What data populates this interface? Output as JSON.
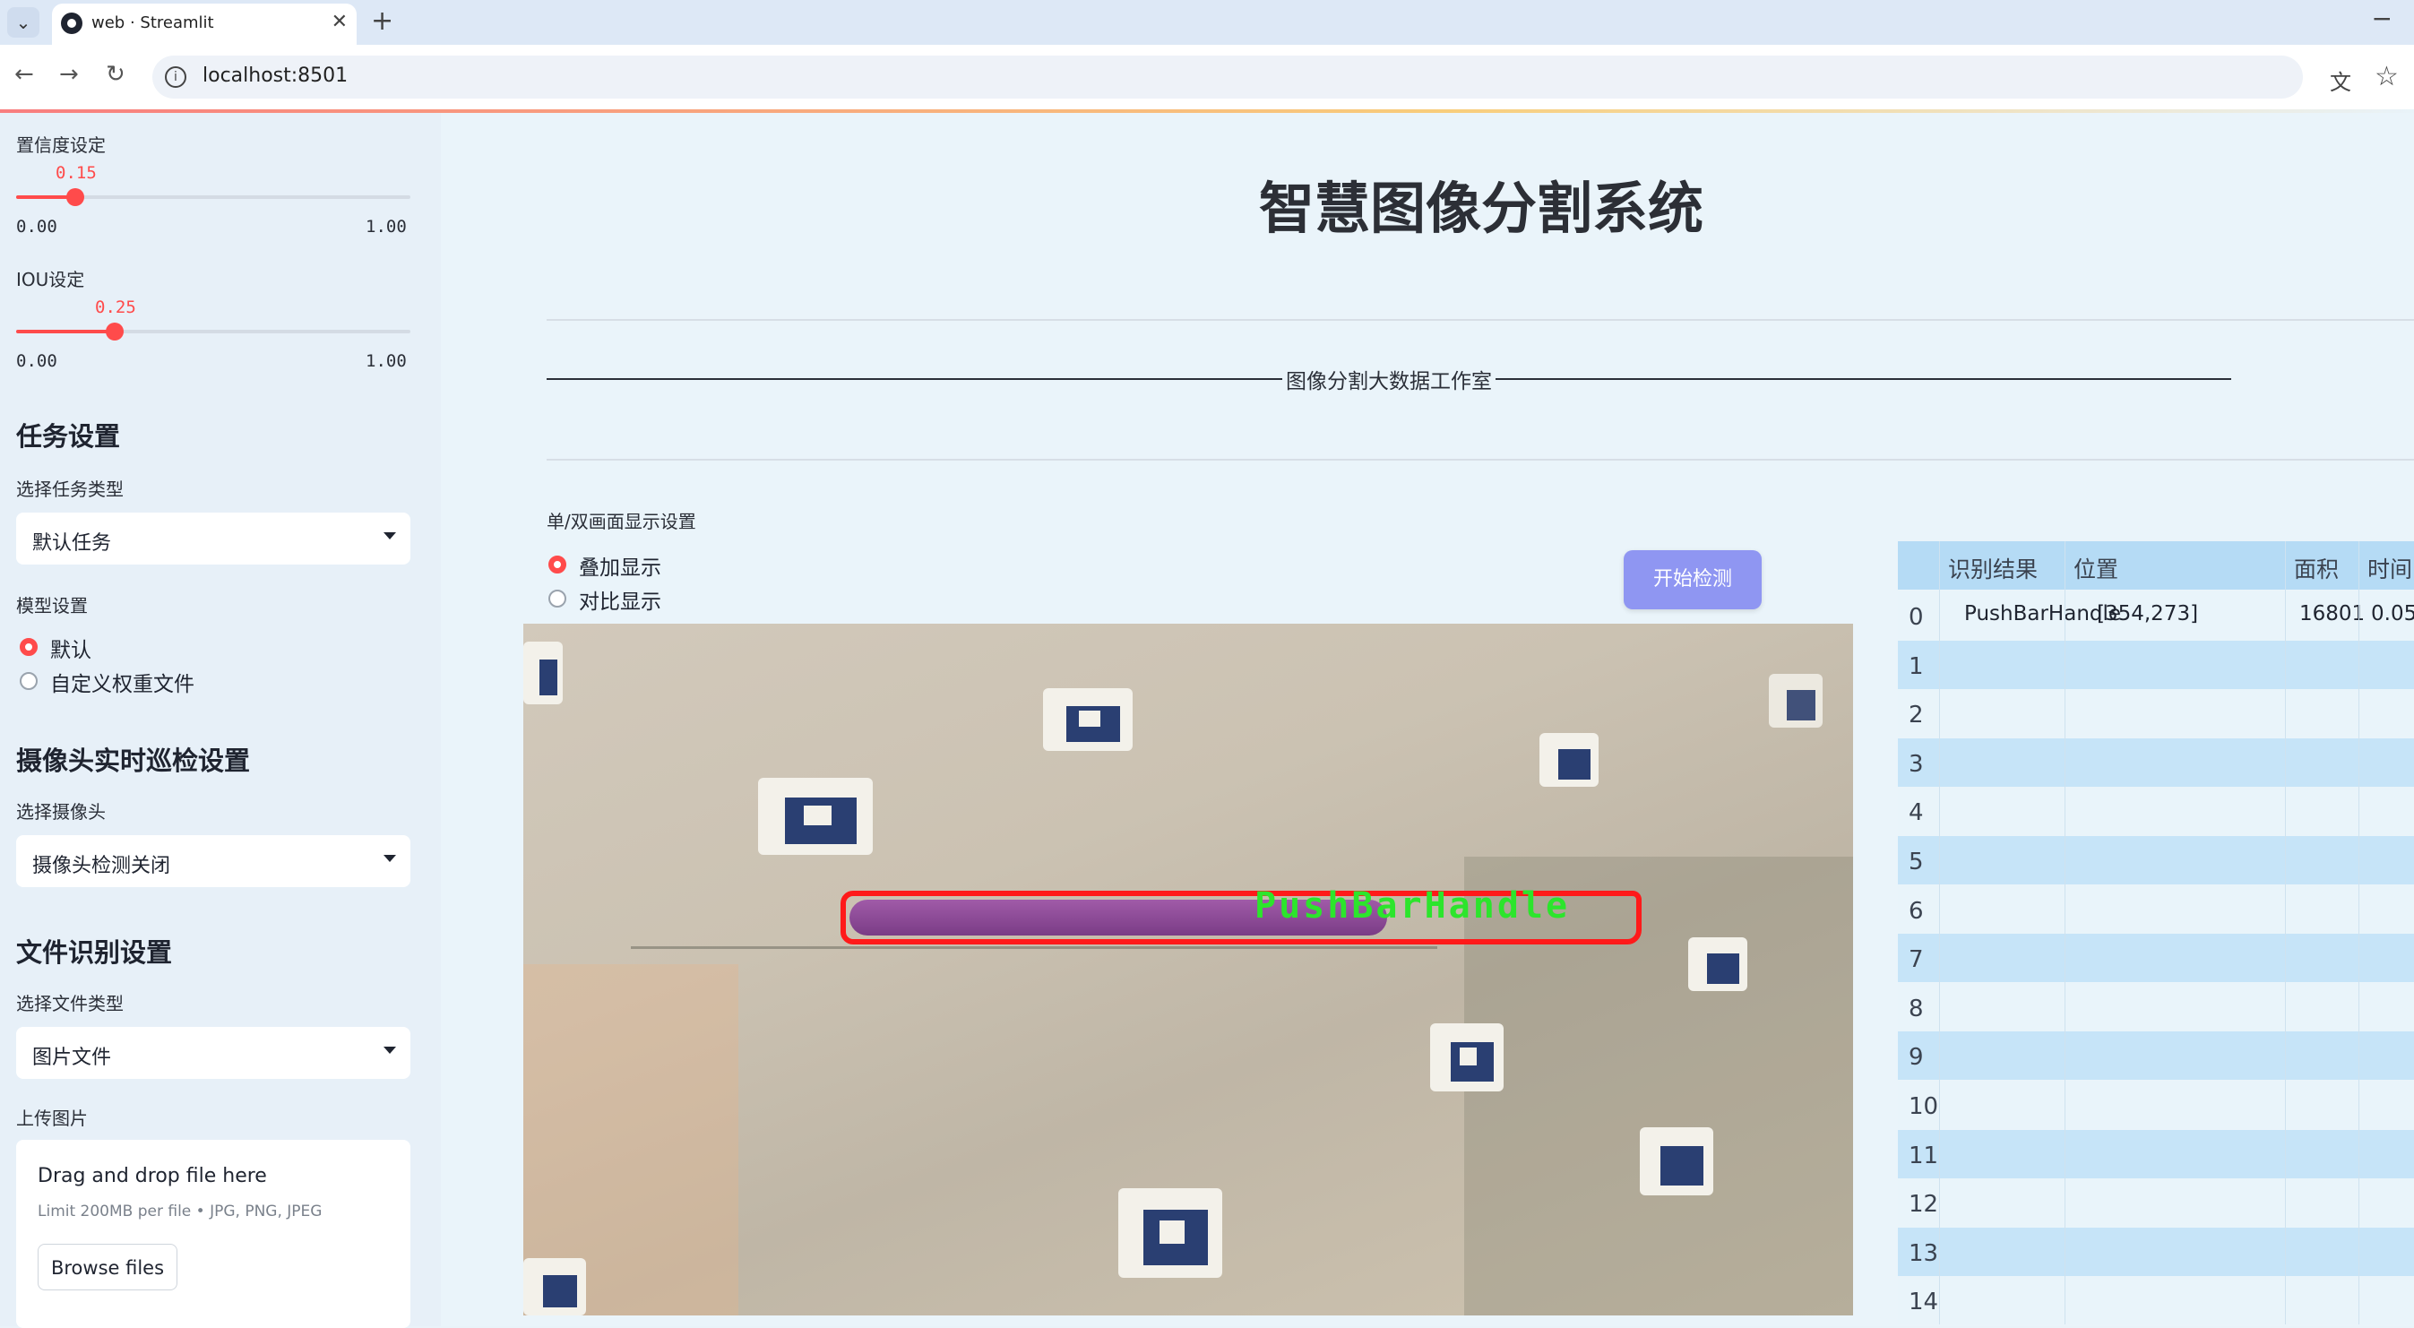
{
  "browser": {
    "tab_title": "web · Streamlit",
    "url": "localhost:8501",
    "new_tab": "+",
    "close_tab": "✕",
    "minimize": "−"
  },
  "sidebar": {
    "confidence": {
      "label": "置信度设定",
      "value": "0.15",
      "value_num": 0.15,
      "min": "0.00",
      "max": "1.00"
    },
    "iou": {
      "label": "IOU设定",
      "value": "0.25",
      "value_num": 0.25,
      "min": "0.00",
      "max": "1.00"
    },
    "task_section": "任务设置",
    "task_type_label": "选择任务类型",
    "task_type_value": "默认任务",
    "model_label": "模型设置",
    "model_options": [
      "默认",
      "自定义权重文件"
    ],
    "model_selected": 0,
    "camera_section": "摄像头实时巡检设置",
    "camera_label": "选择摄像头",
    "camera_value": "摄像头检测关闭",
    "file_section": "文件识别设置",
    "file_type_label": "选择文件类型",
    "file_type_value": "图片文件",
    "upload_label": "上传图片",
    "upload_title": "Drag and drop file here",
    "upload_limit": "Limit 200MB per file • JPG, PNG, JPEG",
    "browse_button": "Browse files"
  },
  "main": {
    "title": "智慧图像分割系统",
    "banner": "图像分割大数据工作室",
    "display_label": "单/双画面显示设置",
    "display_options": [
      "叠加显示",
      "对比显示"
    ],
    "display_selected": 0,
    "start_button": "开始检测",
    "detection_label": "PushBarHandle"
  },
  "table": {
    "columns": [
      "识别结果",
      "位置",
      "面积",
      "时间"
    ],
    "rows": [
      {
        "index": "0",
        "result": "PushBarHandle",
        "position": "[354,273]",
        "area": "16801",
        "time": "0.05"
      },
      {
        "index": "1"
      },
      {
        "index": "2"
      },
      {
        "index": "3"
      },
      {
        "index": "4"
      },
      {
        "index": "5"
      },
      {
        "index": "6"
      },
      {
        "index": "7"
      },
      {
        "index": "8"
      },
      {
        "index": "9"
      },
      {
        "index": "10"
      },
      {
        "index": "11"
      },
      {
        "index": "12"
      },
      {
        "index": "13"
      },
      {
        "index": "14"
      }
    ]
  },
  "colors": {
    "accent": "#ff4b4b",
    "button": "#8f96f2",
    "mask_box": "#ff1a1a",
    "mask_label": "#2ce52c"
  }
}
